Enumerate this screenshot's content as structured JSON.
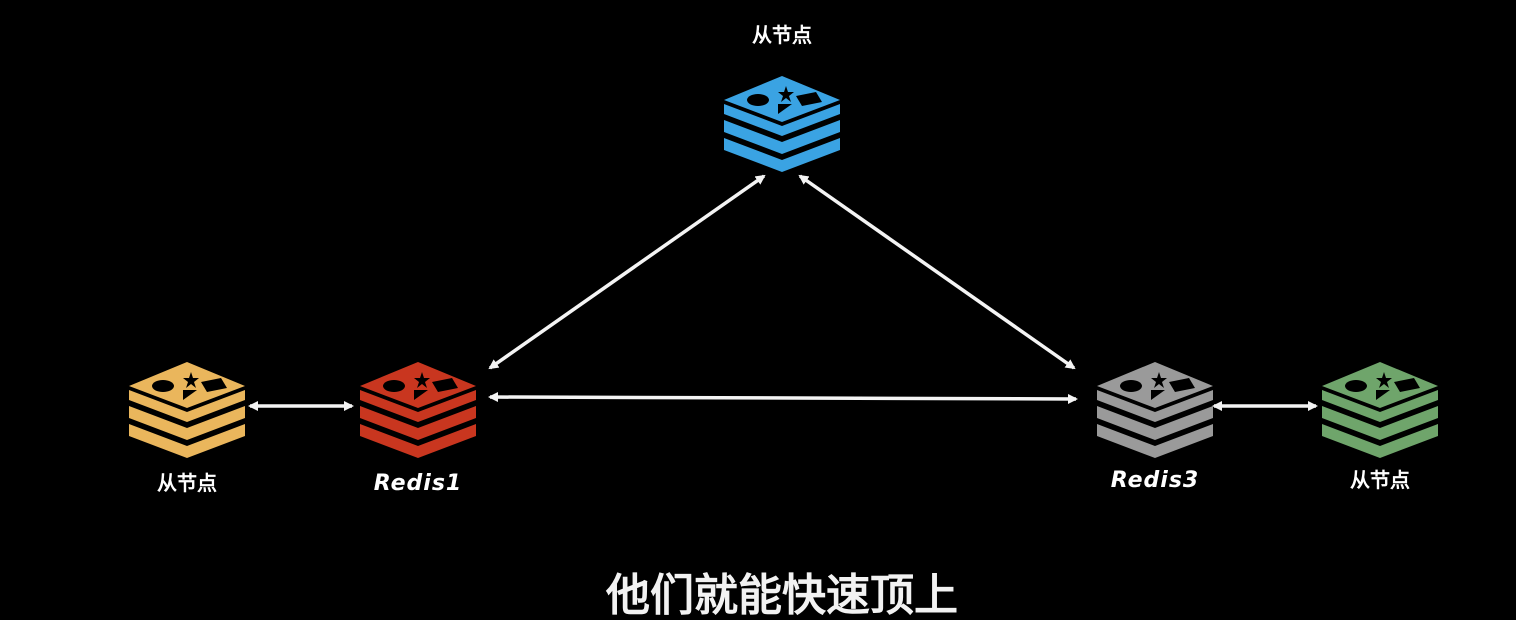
{
  "colors": {
    "background": "#000000",
    "link": "#f4f4f4",
    "label": "#ffffff",
    "caption": "#f2f2f2"
  },
  "nodes": {
    "top": {
      "label": "从节点",
      "color": "#3aa3e3",
      "icon": "redis-stack-icon"
    },
    "left_replica": {
      "label": "从节点",
      "color": "#eab65c",
      "icon": "redis-stack-icon"
    },
    "redis1": {
      "label": "Redis1",
      "color": "#c9361f",
      "icon": "redis-stack-icon"
    },
    "redis3": {
      "label": "Redis3",
      "color": "#9a9a9a",
      "icon": "redis-stack-icon"
    },
    "right_replica": {
      "label": "从节点",
      "color": "#6fa56b",
      "icon": "redis-stack-icon"
    }
  },
  "caption": "他们就能快速顶上"
}
